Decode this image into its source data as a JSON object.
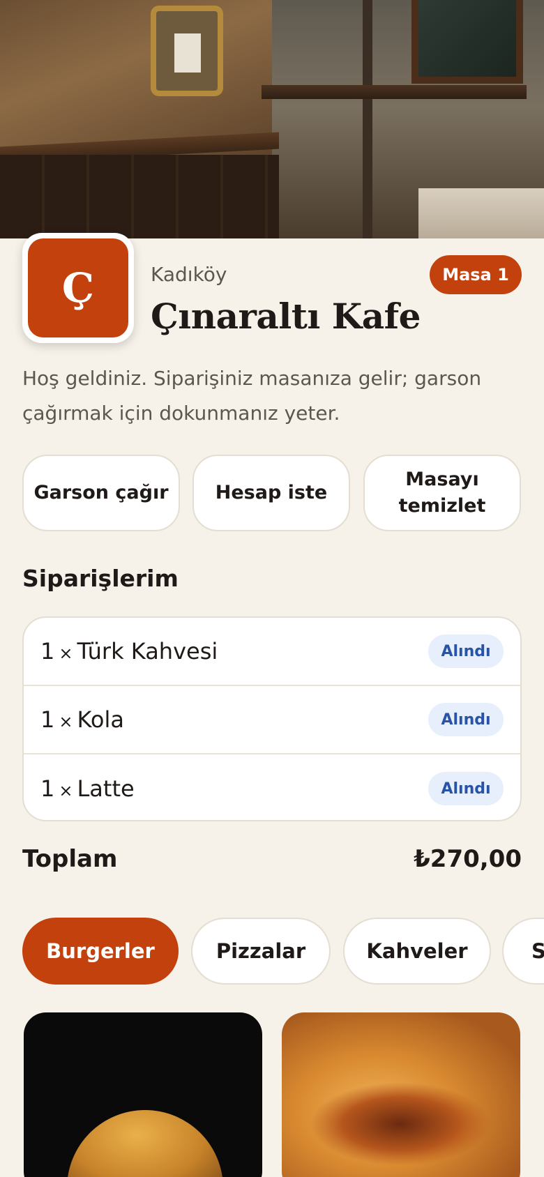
{
  "restaurant": {
    "logo_letter": "Ç",
    "district": "Kadıköy",
    "name": "Çınaraltı Kafe",
    "table_label": "Masa 1",
    "welcome_text": "Hoş geldiniz. Siparişiniz masanıza gelir; garson çağırmak için dokunmanız yeter.",
    "accent_color": "#c2410c"
  },
  "actions": [
    {
      "label": "Garson çağır"
    },
    {
      "label": "Hesap iste"
    },
    {
      "label": "Masayı temizlet"
    }
  ],
  "orders": {
    "title": "Siparişlerim",
    "items": [
      {
        "qty": "1",
        "sep": "×",
        "name": "Türk Kahvesi",
        "status": "Alındı"
      },
      {
        "qty": "1",
        "sep": "×",
        "name": "Kola",
        "status": "Alındı"
      },
      {
        "qty": "1",
        "sep": "×",
        "name": "Latte",
        "status": "Alındı"
      }
    ],
    "total_label": "Toplam",
    "total_value": "₺270,00"
  },
  "categories": [
    {
      "label": "Burgerler",
      "active": true
    },
    {
      "label": "Pizzalar",
      "active": false
    },
    {
      "label": "Kahveler",
      "active": false
    },
    {
      "label": "S",
      "active": false
    }
  ],
  "icons": {
    "hero": "cafe-interior-photo",
    "product_1": "burger-photo",
    "product_2": "cheeseburger-photo"
  }
}
